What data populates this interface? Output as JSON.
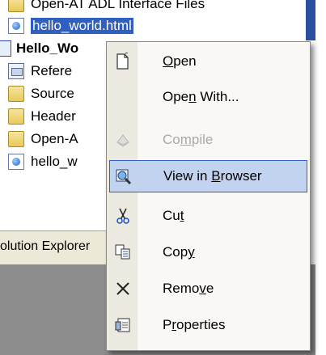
{
  "tree": {
    "items": [
      {
        "label": "Open-AT ADL Interface Files",
        "icon": "folder-icon",
        "level": 1
      },
      {
        "label": "hello_world.html",
        "icon": "html-file-icon",
        "level": 1,
        "selected": true
      },
      {
        "label": "Hello_Wo",
        "icon": "project-icon",
        "level": 0,
        "bold": true
      },
      {
        "label": "Refere",
        "icon": "references-icon",
        "level": 1
      },
      {
        "label": "Source",
        "icon": "folder-icon",
        "level": 1
      },
      {
        "label": "Header",
        "icon": "folder-icon",
        "level": 1
      },
      {
        "label": "Open-A",
        "icon": "folder-icon",
        "level": 1
      },
      {
        "label": "hello_w",
        "icon": "html-file-icon",
        "level": 1
      }
    ]
  },
  "explorer_tab": {
    "label": "olution Explorer"
  },
  "context_menu": {
    "items": [
      {
        "label": "Open",
        "mnemonic": "O",
        "icon": "open-document-icon",
        "disabled": false,
        "highlighted": false
      },
      {
        "label": "Open With...",
        "mnemonic": "n",
        "icon": "",
        "disabled": false,
        "highlighted": false
      },
      {
        "label": "Compile",
        "mnemonic": "m",
        "icon": "compile-icon",
        "disabled": true,
        "highlighted": false
      },
      {
        "label": "View in Browser",
        "mnemonic": "B",
        "icon": "view-in-browser-icon",
        "disabled": false,
        "highlighted": true
      },
      {
        "label": "Cut",
        "mnemonic": "t",
        "icon": "scissors-icon",
        "disabled": false,
        "highlighted": false
      },
      {
        "label": "Copy",
        "mnemonic": "y",
        "icon": "copy-icon",
        "disabled": false,
        "highlighted": false
      },
      {
        "label": "Remove",
        "mnemonic": "v",
        "icon": "remove-x-icon",
        "disabled": false,
        "highlighted": false
      },
      {
        "label": "Properties",
        "mnemonic": "r",
        "icon": "properties-icon",
        "disabled": false,
        "highlighted": false
      }
    ]
  },
  "colors": {
    "selection": "#2f5fc0",
    "menu_highlight": "#c2d3f0",
    "menu_highlight_border": "#3161c4",
    "disabled_text": "#a8a8a8"
  }
}
